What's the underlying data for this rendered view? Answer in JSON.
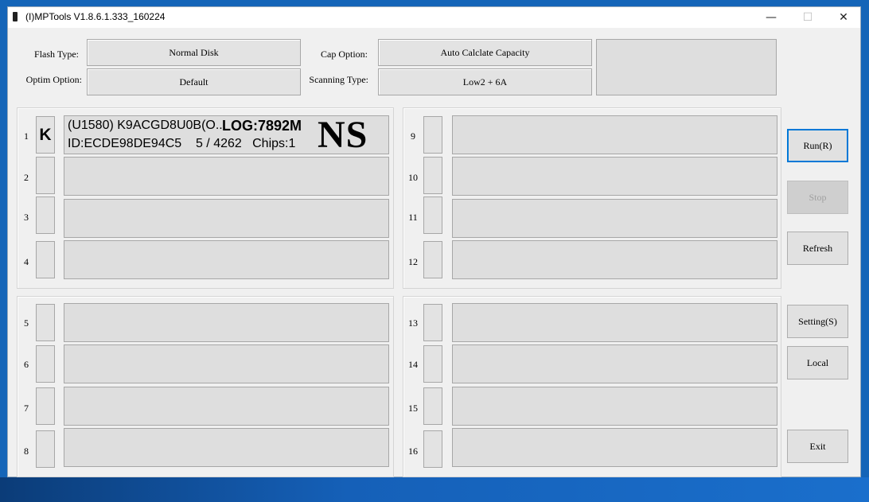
{
  "window": {
    "title": "(I)MPTools V1.8.6.1.333_160224",
    "minimize": "—",
    "maximize": "☐",
    "close": "✕"
  },
  "options": {
    "flash_type_label": "Flash Type:",
    "flash_type_value": "Normal Disk",
    "optim_option_label": "Optim Option:",
    "optim_option_value": "Default",
    "cap_option_label": "Cap Option:",
    "cap_option_value": "Auto Calclate Capacity",
    "scanning_type_label": "Scanning Type:",
    "scanning_type_value": "Low2 + 6A"
  },
  "ports": [
    {
      "num": "1",
      "led": "K",
      "line1": "(U1580) K9ACGD8U0B(O...",
      "log": "LOG:7892M",
      "line2": "ID:ECDE98DE94C5    5 / 4262   Chips:1",
      "badge": "NS"
    },
    {
      "num": "2"
    },
    {
      "num": "3"
    },
    {
      "num": "4"
    },
    {
      "num": "5"
    },
    {
      "num": "6"
    },
    {
      "num": "7"
    },
    {
      "num": "8"
    },
    {
      "num": "9"
    },
    {
      "num": "10"
    },
    {
      "num": "11"
    },
    {
      "num": "12"
    },
    {
      "num": "13"
    },
    {
      "num": "14"
    },
    {
      "num": "15"
    },
    {
      "num": "16"
    }
  ],
  "buttons": {
    "run": "Run(R)",
    "stop": "Stop",
    "refresh": "Refresh",
    "setting": "Setting(S)",
    "local": "Local",
    "exit": "Exit"
  }
}
